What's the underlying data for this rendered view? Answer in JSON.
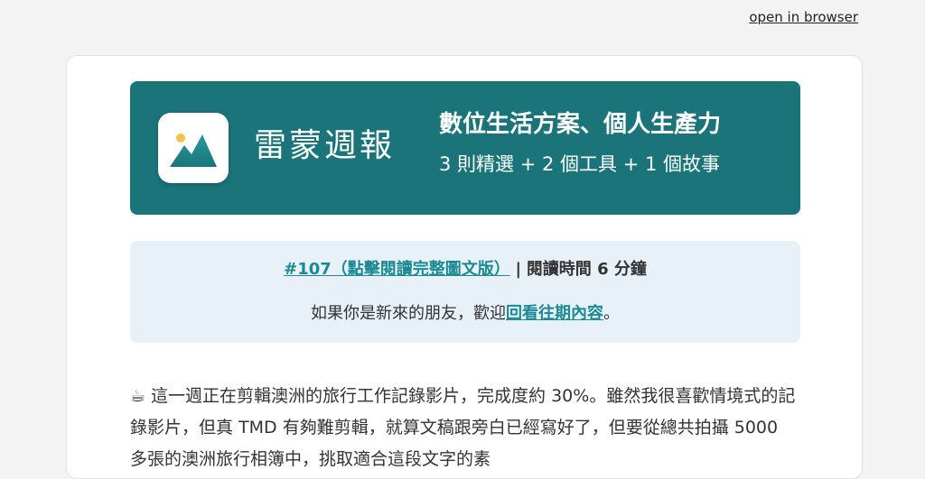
{
  "topbar": {
    "open_in_browser": "open in browser"
  },
  "banner": {
    "brand": "雷蒙週報",
    "tagline_title": "數位生活方案、個人生產力",
    "tagline_sub": "3 則精選 + 2 個工具 + 1 個故事",
    "bg_color": "#1a747a",
    "logo_icon": "landscape-image-icon"
  },
  "notice": {
    "issue_link": "#107（點擊閱讀完整圖文版）",
    "separator": "|",
    "read_time": "閱讀時間 6 分鐘",
    "welcome_prefix": "如果你是新來的朋友，歡迎",
    "welcome_link": "回看往期內容",
    "welcome_suffix": "。",
    "link_color": "#1a8a95"
  },
  "article": {
    "cup_icon": "☕",
    "paragraph": "這一週正在剪輯澳洲的旅行工作記錄影片，完成度約 30%。雖然我很喜歡情境式的記錄影片，但真 TMD 有夠難剪輯，就算文稿跟旁白已經寫好了，但要從總共拍攝 5000 多張的澳洲旅行相簿中，挑取適合這段文字的素"
  }
}
